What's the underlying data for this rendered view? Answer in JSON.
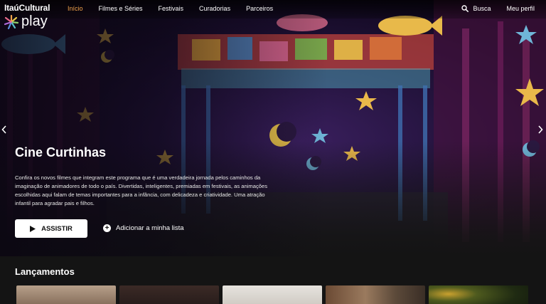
{
  "brand": {
    "name": "ItaúCultural",
    "product": "play"
  },
  "nav": {
    "items": [
      {
        "label": "Início",
        "active": true
      },
      {
        "label": "Filmes e Séries",
        "active": false
      },
      {
        "label": "Festivais",
        "active": false
      },
      {
        "label": "Curadorias",
        "active": false
      },
      {
        "label": "Parceiros",
        "active": false
      }
    ],
    "search_label": "Busca",
    "profile_label": "Meu perfil"
  },
  "hero": {
    "title": "Cine Curtinhas",
    "description": "Confira os novos filmes que integram este programa que é uma verdadeira jornada pelos caminhos da imaginação de animadores de todo o país. Divertidas, inteligentes, premiadas em festivais, as animações escolhidas aqui falam de temas importantes para a infância, com delicadeza e criatividade. Uma atração infantil para agradar pais e filhos.",
    "watch_label": "ASSISTIR",
    "add_list_label": "Adicionar a minha lista"
  },
  "releases": {
    "title": "Lançamentos",
    "items": [
      "thumb-1",
      "thumb-2",
      "thumb-3",
      "thumb-4",
      "thumb-5"
    ]
  },
  "colors": {
    "active_nav": "#f0a24b",
    "background": "#141414"
  }
}
